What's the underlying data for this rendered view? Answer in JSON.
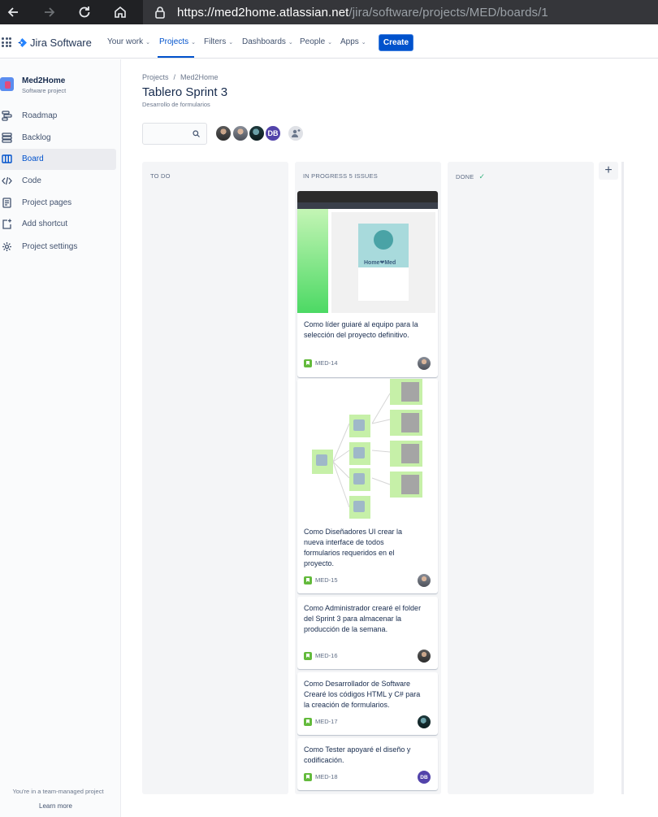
{
  "browser": {
    "url_host": "https://med2home.atlassian.net",
    "url_path": "/jira/software/projects/MED/boards/1"
  },
  "topnav": {
    "product": "Jira Software",
    "items": [
      {
        "label": "Your work",
        "has_menu": true
      },
      {
        "label": "Projects",
        "has_menu": true,
        "active": true
      },
      {
        "label": "Filters",
        "has_menu": true
      },
      {
        "label": "Dashboards",
        "has_menu": true
      },
      {
        "label": "People",
        "has_menu": true
      },
      {
        "label": "Apps",
        "has_menu": true
      }
    ],
    "create_label": "Create"
  },
  "sidebar": {
    "project_name": "Med2Home",
    "project_type": "Software project",
    "items": [
      {
        "label": "Roadmap",
        "icon": "roadmap-icon"
      },
      {
        "label": "Backlog",
        "icon": "backlog-icon"
      },
      {
        "label": "Board",
        "icon": "board-icon",
        "selected": true
      },
      {
        "label": "Code",
        "icon": "code-icon"
      },
      {
        "label": "Project pages",
        "icon": "pages-icon"
      },
      {
        "label": "Add shortcut",
        "icon": "add-shortcut-icon"
      },
      {
        "label": "Project settings",
        "icon": "settings-icon"
      }
    ],
    "footer_text": "You're in a team-managed project",
    "learn_more": "Learn more"
  },
  "main": {
    "breadcrumb": [
      "Projects",
      "Med2Home"
    ],
    "title": "Tablero Sprint 3",
    "subtitle": "Desarrollo de formularios",
    "search_placeholder": "",
    "avatars": [
      "photo",
      "photo",
      "photo",
      "DB"
    ],
    "db_initials": "DB"
  },
  "columns": [
    {
      "title": "TO DO"
    },
    {
      "title": "IN PROGRESS 5 ISSUES"
    },
    {
      "title": "DONE"
    }
  ],
  "cards": [
    {
      "key": "MED-14",
      "summary": "Como líder guiaré al equipo para la selección del proyecto definitivo.",
      "cover": "app-screenshot",
      "assignee": "photo"
    },
    {
      "key": "MED-15",
      "summary": "Como Diseñadores UI crear la nueva interface de todos formularios requeridos en el proyecto.",
      "cover": "flow-diagram",
      "assignee": "photo"
    },
    {
      "key": "MED-16",
      "summary": "Como Administrador crearé el folder del Sprint 3 para almacenar la producción de la semana.",
      "assignee": "photo"
    },
    {
      "key": "MED-17",
      "summary": "Como Desarrollador de Software Crearé los códigos HTML y C# para la creación de formularios.",
      "assignee": "photo"
    },
    {
      "key": "MED-18",
      "summary": "Como Tester apoyaré el diseño y codificación.",
      "assignee": "DB"
    }
  ],
  "cover_brand": "Home❤Med",
  "colors": {
    "brand_blue": "#0052cc",
    "story_green": "#63ba3c",
    "done_check": "#36b37e",
    "db_avatar": "#5243aa"
  }
}
